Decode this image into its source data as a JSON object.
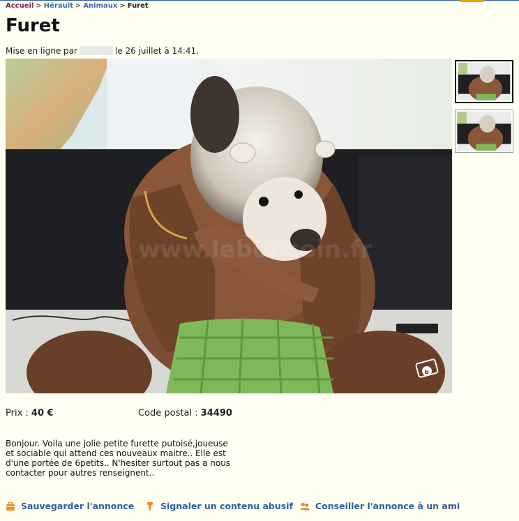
{
  "breadcrumb": {
    "home": "Accueil",
    "sep1": ">",
    "region": "Hérault",
    "sep2": ">",
    "category": "Animaux",
    "sep3": ">",
    "current": "Furet"
  },
  "listing": {
    "title": "Furet",
    "posted_prefix": "Mise en ligne par",
    "posted_date": "le 26 juillet à 14:41.",
    "price_label": "Prix :",
    "price_value": "40 €",
    "postal_label": "Code postal :",
    "postal_value": "34490",
    "description_lines": [
      "Bonjour. Voila une jolie petite furette putoisé,joueuse",
      "et sociable qui attend ces nouveaux maitre.. Elle est",
      "d'une portée de 6petits.. N'hesiter surtout pas a nous",
      "contacter pour autres renseignent.."
    ]
  },
  "photo": {
    "watermark": "www.leboncoin.fr",
    "thumbnail_count": 2,
    "selected_thumbnail": 1
  },
  "actions": {
    "save": "Sauvegarder l'annonce",
    "report": "Signaler un contenu abusif",
    "share": "Conseiller l'annonce à un ami"
  },
  "colors": {
    "background": "#fffff2",
    "link": "#2f5e9e",
    "home_link": "#7a2450",
    "action_icon": "#f28c28"
  },
  "icons": {
    "save": "briefcase-icon",
    "report": "pin-icon",
    "share": "people-icon",
    "camera": "camera-icon"
  }
}
